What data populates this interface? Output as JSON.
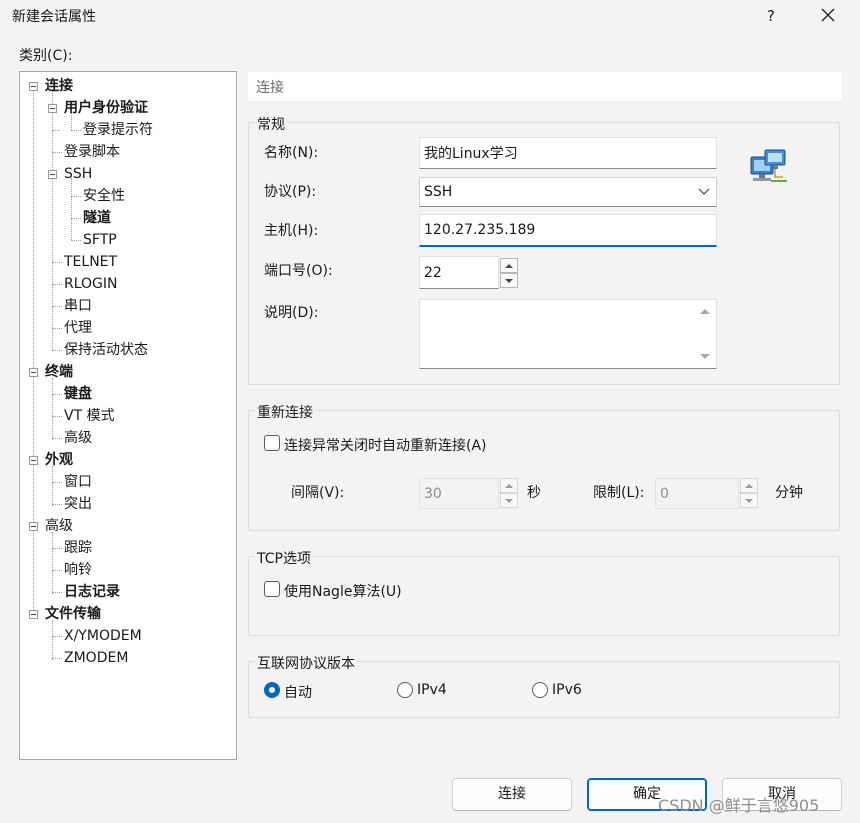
{
  "window": {
    "title": "新建会话属性",
    "help_symbol": "?",
    "close_icon": "close-icon"
  },
  "category_label": "类别(C):",
  "tree": {
    "items": [
      {
        "label": "连接",
        "bold": true
      },
      {
        "label": "用户身份验证",
        "bold": true
      },
      {
        "label": "登录提示符",
        "bold": false
      },
      {
        "label": "登录脚本",
        "bold": false
      },
      {
        "label": "SSH",
        "bold": false
      },
      {
        "label": "安全性",
        "bold": false
      },
      {
        "label": "隧道",
        "bold": true
      },
      {
        "label": "SFTP",
        "bold": false
      },
      {
        "label": "TELNET",
        "bold": false
      },
      {
        "label": "RLOGIN",
        "bold": false
      },
      {
        "label": "串口",
        "bold": false
      },
      {
        "label": "代理",
        "bold": false
      },
      {
        "label": "保持活动状态",
        "bold": false
      },
      {
        "label": "终端",
        "bold": true
      },
      {
        "label": "键盘",
        "bold": true
      },
      {
        "label": "VT 模式",
        "bold": false
      },
      {
        "label": "高级",
        "bold": false
      },
      {
        "label": "外观",
        "bold": true
      },
      {
        "label": "窗口",
        "bold": false
      },
      {
        "label": "突出",
        "bold": false
      },
      {
        "label": "高级",
        "bold": false
      },
      {
        "label": "跟踪",
        "bold": false
      },
      {
        "label": "响铃",
        "bold": false
      },
      {
        "label": "日志记录",
        "bold": true
      },
      {
        "label": "文件传输",
        "bold": true
      },
      {
        "label": "X/YMODEM",
        "bold": false
      },
      {
        "label": "ZMODEM",
        "bold": false
      }
    ]
  },
  "panel_header": "连接",
  "general": {
    "title": "常规",
    "name_label": "名称(N):",
    "name_value": "我的Linux学习",
    "protocol_label": "协议(P):",
    "protocol_value": "SSH",
    "host_label": "主机(H):",
    "host_value": "120.27.235.189",
    "port_label": "端口号(O):",
    "port_value": "22",
    "desc_label": "说明(D):",
    "desc_value": "",
    "icon": "network-computers-icon"
  },
  "reconnect": {
    "title": "重新连接",
    "checkbox_label": "连接异常关闭时自动重新连接(A)",
    "checked": false,
    "interval_label": "间隔(V):",
    "interval_value": "30",
    "interval_unit": "秒",
    "limit_label": "限制(L):",
    "limit_value": "0",
    "limit_unit": "分钟"
  },
  "tcp": {
    "title": "TCP选项",
    "nagle_label": "使用Nagle算法(U)",
    "checked": false
  },
  "ip_version": {
    "title": "互联网协议版本",
    "options": [
      {
        "label": "自动",
        "selected": true
      },
      {
        "label": "IPv4",
        "selected": false
      },
      {
        "label": "IPv6",
        "selected": false
      }
    ]
  },
  "buttons": {
    "connect": "连接",
    "ok": "确定",
    "cancel": "取消"
  },
  "watermark": "CSDN @鲜于言悠905",
  "colors": {
    "accent": "#0067c0",
    "background": "#f3f3f3"
  }
}
